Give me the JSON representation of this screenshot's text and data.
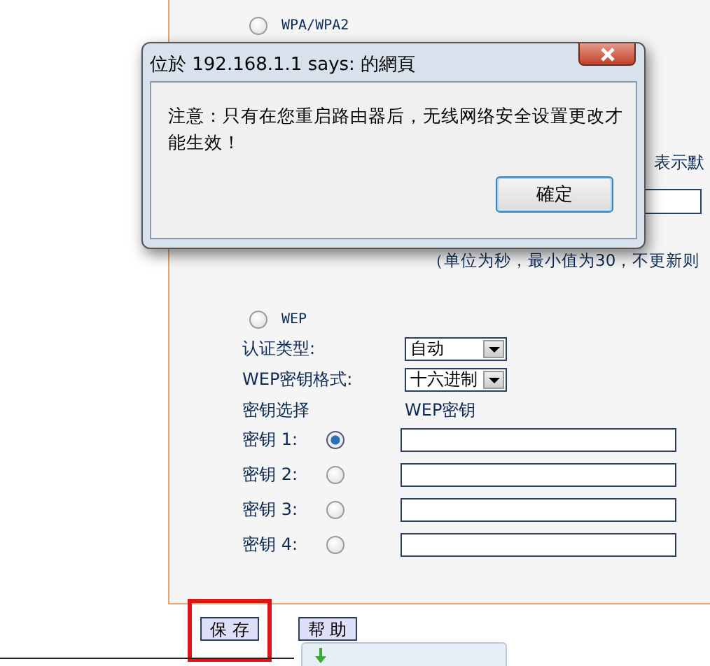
{
  "top_option": {
    "label": "WPA/WPA2",
    "selected": false
  },
  "hidden_hint": "表示默",
  "interval_note": "（单位为秒，最小值为30，不更新则",
  "wep_option": {
    "label": "WEP",
    "selected": false
  },
  "auth_type": {
    "label": "认证类型:",
    "value": "自动"
  },
  "key_format": {
    "label": "WEP密钥格式:",
    "value": "十六进制"
  },
  "key_header": {
    "select": "密钥选择",
    "key": "WEP密钥"
  },
  "keys": [
    {
      "label": "密钥 1:",
      "selected": true
    },
    {
      "label": "密钥 2:",
      "selected": false
    },
    {
      "label": "密钥 3:",
      "selected": false
    },
    {
      "label": "密钥 4:",
      "selected": false
    }
  ],
  "buttons": [
    {
      "label": "保 存",
      "highlighted": true
    },
    {
      "label": "帮 助",
      "highlighted": false
    }
  ],
  "dialog": {
    "title": "位於 192.168.1.1 says: 的網頁",
    "message": "注意：只有在您重启路由器后，无线网络安全设置更改才能生效！",
    "ok": "確定"
  }
}
